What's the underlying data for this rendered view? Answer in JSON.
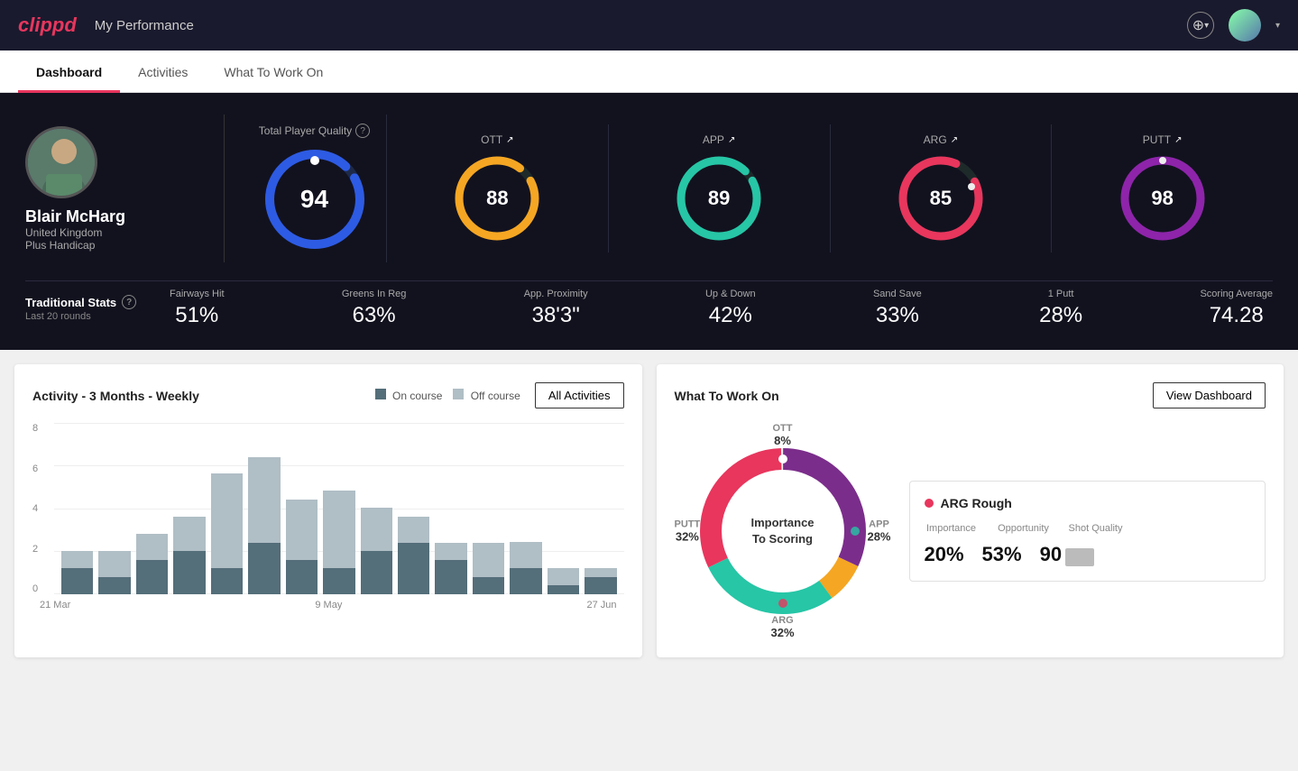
{
  "header": {
    "logo": "clippd",
    "title": "My Performance",
    "add_icon": "+",
    "dropdown_icon": "▾"
  },
  "nav": {
    "tabs": [
      {
        "label": "Dashboard",
        "active": true
      },
      {
        "label": "Activities",
        "active": false
      },
      {
        "label": "What To Work On",
        "active": false
      }
    ]
  },
  "player": {
    "name": "Blair McHarg",
    "country": "United Kingdom",
    "handicap": "Plus Handicap"
  },
  "metrics": {
    "tpq": {
      "label": "Total Player Quality",
      "value": "94"
    },
    "ott": {
      "label": "OTT",
      "value": "88"
    },
    "app": {
      "label": "APP",
      "value": "89"
    },
    "arg": {
      "label": "ARG",
      "value": "85"
    },
    "putt": {
      "label": "PUTT",
      "value": "98"
    }
  },
  "traditional_stats": {
    "title": "Traditional Stats",
    "subtitle": "Last 20 rounds",
    "items": [
      {
        "name": "Fairways Hit",
        "value": "51%"
      },
      {
        "name": "Greens In Reg",
        "value": "63%"
      },
      {
        "name": "App. Proximity",
        "value": "38'3\""
      },
      {
        "name": "Up & Down",
        "value": "42%"
      },
      {
        "name": "Sand Save",
        "value": "33%"
      },
      {
        "name": "1 Putt",
        "value": "28%"
      },
      {
        "name": "Scoring Average",
        "value": "74.28"
      }
    ]
  },
  "activity_chart": {
    "title": "Activity - 3 Months - Weekly",
    "legend": {
      "on_course": "On course",
      "off_course": "Off course"
    },
    "all_activities_btn": "All Activities",
    "y_labels": [
      "0",
      "2",
      "4",
      "6",
      "8"
    ],
    "x_labels": [
      "21 Mar",
      "9 May",
      "27 Jun"
    ],
    "bars": [
      {
        "on": 15,
        "off": 10
      },
      {
        "on": 10,
        "off": 15
      },
      {
        "on": 20,
        "off": 15
      },
      {
        "on": 25,
        "off": 20
      },
      {
        "on": 15,
        "off": 55
      },
      {
        "on": 30,
        "off": 50
      },
      {
        "on": 20,
        "off": 35
      },
      {
        "on": 15,
        "off": 45
      },
      {
        "on": 25,
        "off": 25
      },
      {
        "on": 30,
        "off": 15
      },
      {
        "on": 20,
        "off": 10
      },
      {
        "on": 10,
        "off": 20
      },
      {
        "on": 15,
        "off": 15
      },
      {
        "on": 5,
        "off": 10
      },
      {
        "on": 10,
        "off": 5
      }
    ]
  },
  "what_to_work_on": {
    "title": "What To Work On",
    "view_dashboard_btn": "View Dashboard",
    "donut_center": "Importance\nTo Scoring",
    "segments": [
      {
        "label": "OTT",
        "value": "8%",
        "color": "#f5a623"
      },
      {
        "label": "APP",
        "value": "28%",
        "color": "#26c6a6"
      },
      {
        "label": "ARG",
        "value": "32%",
        "color": "#e8365d"
      },
      {
        "label": "PUTT",
        "value": "32%",
        "color": "#7b2d8b"
      }
    ],
    "info_card": {
      "title": "ARG Rough",
      "metrics_headers": [
        "Importance",
        "Opportunity",
        "Shot Quality"
      ],
      "metrics_values": [
        "20%",
        "53%",
        "90"
      ]
    }
  }
}
